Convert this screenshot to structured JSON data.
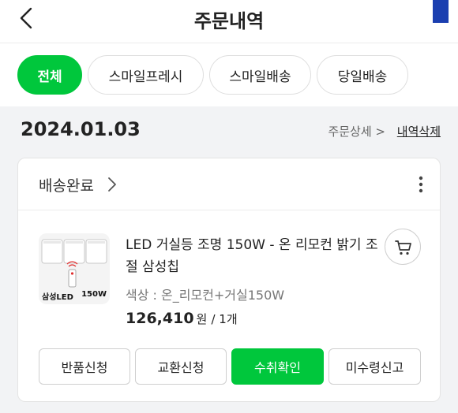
{
  "header": {
    "title": "주문내역",
    "back_icon": "chevron-left-icon"
  },
  "tabs": [
    {
      "label": "전체",
      "active": true
    },
    {
      "label": "스마일프레시",
      "active": false
    },
    {
      "label": "스마일배송",
      "active": false
    },
    {
      "label": "당일배송",
      "active": false
    }
  ],
  "order": {
    "date": "2024.01.03",
    "detail_link": "주문상세 >",
    "delete_link": "내역삭제",
    "status": "배송완료",
    "item": {
      "name": "LED 거실등 조명 150W - 온 리모컨 밝기 조절 삼성칩",
      "option": "색상 : 온_리모컨+거실150W",
      "price": "126,410",
      "price_unit": "원",
      "quantity": "/ 1개",
      "thumb_label": "삼성LED",
      "thumb_badge": "150W"
    },
    "actions": [
      {
        "label": "반품신청",
        "primary": false
      },
      {
        "label": "교환신청",
        "primary": false
      },
      {
        "label": "수취확인",
        "primary": true
      },
      {
        "label": "미수령신고",
        "primary": false
      }
    ]
  },
  "colors": {
    "accent": "#00c73c",
    "corner_mark": "#1b3fb0"
  }
}
